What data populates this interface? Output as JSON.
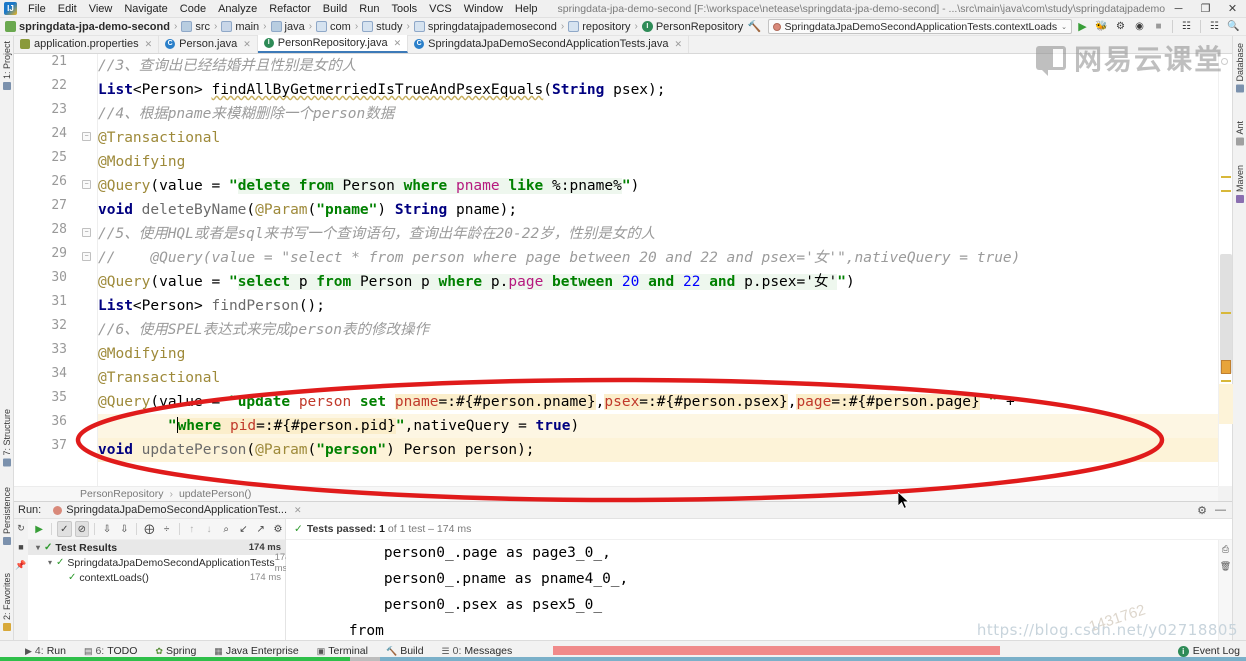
{
  "window": {
    "title": "springdata-jpa-demo-second [F:\\workspace\\netease\\springdata-jpa-demo-second] - ...\\src\\main\\java\\com\\study\\springdatajpademosecond\\repository\\PersonRepository.java - IntelliJ IDEA",
    "logo_letters": "IJ",
    "minimize": "─",
    "maximize": "❐",
    "close": "✕"
  },
  "menu": [
    "File",
    "Edit",
    "View",
    "Navigate",
    "Code",
    "Analyze",
    "Refactor",
    "Build",
    "Run",
    "Tools",
    "VCS",
    "Window",
    "Help"
  ],
  "breadcrumb": [
    {
      "label": "springdata-jpa-demo-second",
      "icon": "project-icon",
      "bold": true
    },
    {
      "label": "src",
      "icon": "folder-icon"
    },
    {
      "label": "main",
      "icon": "folder-icon"
    },
    {
      "label": "java",
      "icon": "source-folder-icon"
    },
    {
      "label": "com",
      "icon": "package-icon"
    },
    {
      "label": "study",
      "icon": "package-icon"
    },
    {
      "label": "springdatajpademosecond",
      "icon": "package-icon"
    },
    {
      "label": "repository",
      "icon": "package-icon"
    },
    {
      "label": "PersonRepository",
      "icon": "interface-icon",
      "glyph": "I"
    }
  ],
  "toolbar": {
    "build_icon": "hammer-icon",
    "run_config": "SpringdataJpaDemoSecondApplicationTests.contextLoads",
    "chevron": "⌄",
    "run_icon": "run-icon",
    "debug_icon": "debug-icon",
    "run_coverage_icon": "run-with-coverage-icon",
    "profile_icon": "profile-icon",
    "stop_icon": "stop-icon",
    "layout_icon": "layout-icon",
    "updates_icon": "updates-icon",
    "search_icon": "search-icon"
  },
  "tabs": [
    {
      "label": "application.properties",
      "icon": "properties-file-icon",
      "glyph": "",
      "active": false
    },
    {
      "label": "Person.java",
      "icon": "java-class-icon",
      "glyph": "C",
      "active": false
    },
    {
      "label": "PersonRepository.java",
      "icon": "java-interface-icon",
      "glyph": "I",
      "active": true
    },
    {
      "label": "SpringdataJpaDemoSecondApplicationTests.java",
      "icon": "java-class-icon",
      "glyph": "C",
      "active": false
    }
  ],
  "left_tool_tabs": [
    {
      "label": "1: Project",
      "icon": "project-panel-icon"
    },
    {
      "label": "7: Structure",
      "icon": "structure-panel-icon"
    },
    {
      "label": "Persistence",
      "icon": "persistence-panel-icon"
    },
    {
      "label": "2: Favorites",
      "icon": "favorites-star-icon"
    }
  ],
  "right_tool_tabs": [
    {
      "label": "Database",
      "icon": "database-panel-icon"
    },
    {
      "label": "Ant",
      "icon": "ant-panel-icon"
    },
    {
      "label": "Maven",
      "icon": "maven-panel-icon"
    }
  ],
  "editor": {
    "first_line": 21,
    "lines": [
      {
        "n": 21,
        "fold": false,
        "highlight": false
      },
      {
        "n": 22,
        "fold": false,
        "highlight": false
      },
      {
        "n": 23,
        "fold": false,
        "highlight": false
      },
      {
        "n": 24,
        "fold": true,
        "highlight": false
      },
      {
        "n": 25,
        "fold": false,
        "highlight": false
      },
      {
        "n": 26,
        "fold": true,
        "highlight": false
      },
      {
        "n": 27,
        "fold": false,
        "highlight": false
      },
      {
        "n": 28,
        "fold": true,
        "highlight": false
      },
      {
        "n": 29,
        "fold": true,
        "highlight": false
      },
      {
        "n": 30,
        "fold": false,
        "highlight": false
      },
      {
        "n": 31,
        "fold": false,
        "highlight": false
      },
      {
        "n": 32,
        "fold": false,
        "highlight": false
      },
      {
        "n": 33,
        "fold": false,
        "highlight": false
      },
      {
        "n": 34,
        "fold": false,
        "highlight": false
      },
      {
        "n": 35,
        "fold": false,
        "highlight": true
      },
      {
        "n": 36,
        "fold": false,
        "highlight": true
      },
      {
        "n": 37,
        "fold": false,
        "highlight": false
      }
    ],
    "code": {
      "l21": "//3、查询出已经结婚并且性别是女的人",
      "l22": "List<Person> findAllByGetmerriedIsTrueAndPsexEquals(String psex);",
      "l23": "//4、根据pname来模糊删除一个person数据",
      "l24": "@Transactional",
      "l25": "@Modifying",
      "l26": "@Query(value = \"delete from Person where pname like %:pname%\")",
      "l27": "void deleteByName(@Param(\"pname\") String pname);",
      "l28": "//5、使用HQL或者是sql来书写一个查询语句，查询出年龄在20-22岁，性别是女的人",
      "l29": "//    @Query(value = \"select * from person where page between 20 and 22 and psex='女'\",nativeQuery = true)",
      "l30": "@Query(value = \"select p from Person p where p.page between 20 and 22 and p.psex='女'\")",
      "l31": "List<Person> findPerson();",
      "l32": "//6、使用SPEL表达式来完成person表的修改操作",
      "l33": "@Modifying",
      "l34": "@Transactional",
      "l35": "@Query(value = \"update person set pname=:#{#person.pname},psex=:#{#person.psex},page=:#{#person.page} \" +",
      "l36": "        \"where pid=:#{#person.pid}\",nativeQuery = true)",
      "l37": "void updatePerson(@Param(\"person\") Person person);"
    },
    "breadcrumb": [
      "PersonRepository",
      "updatePerson()"
    ],
    "breadcrumb_sep": "›"
  },
  "run_panel": {
    "run_label": "Run:",
    "tab_title": "SpringdataJpaDemoSecondApplicationTest...",
    "close_glyph": "✕",
    "settings_icon": "gear-icon",
    "minimize_icon": "hide-icon",
    "toolbar_buttons": [
      {
        "name": "rerun-tests-icon",
        "glyph": "▶"
      },
      {
        "name": "show-passed-icon",
        "glyph": "✓",
        "active": true
      },
      {
        "name": "show-ignored-icon",
        "glyph": "⊘",
        "active": true
      },
      {
        "name": "sort-alphabetically-icon",
        "glyph": "↓ᴀ"
      },
      {
        "name": "sort-by-duration-icon",
        "glyph": "↓≡"
      },
      {
        "name": "expand-all-icon",
        "glyph": "⩟"
      },
      {
        "name": "collapse-all-icon",
        "glyph": "÷"
      },
      {
        "name": "previous-failed-icon",
        "glyph": "↑"
      },
      {
        "name": "next-failed-icon",
        "glyph": "↓"
      },
      {
        "name": "search-tests-icon",
        "glyph": "⌕"
      },
      {
        "name": "import-tests-icon",
        "glyph": "↙"
      },
      {
        "name": "export-tests-icon",
        "glyph": "↗"
      },
      {
        "name": "test-settings-icon",
        "glyph": "⚙"
      }
    ],
    "status": {
      "check": "✓",
      "prefix": "Tests passed:",
      "count": "1",
      "suffix": "of 1 test – 174 ms"
    },
    "tree": [
      {
        "label": "Test Results",
        "time": "174 ms",
        "depth": 0,
        "expanded": true,
        "selected": true
      },
      {
        "label": "SpringdataJpaDemoSecondApplicationTests",
        "time": "174 ms",
        "depth": 1,
        "expanded": true,
        "selected": false
      },
      {
        "label": "contextLoads()",
        "time": "174 ms",
        "depth": 2,
        "expanded": false,
        "selected": false
      }
    ],
    "console_lines": [
      "        person0_.page as page3_0_,",
      "        person0_.pname as pname4_0_,",
      "        person0_.psex as psex5_0_",
      "    from"
    ],
    "console_side_icons": [
      {
        "name": "print-icon",
        "glyph": "⎙"
      },
      {
        "name": "delete-icon",
        "glyph": "Ὕ1"
      }
    ]
  },
  "statusbar": {
    "items": [
      {
        "label": "Run",
        "icon": "run-tool-icon",
        "prefix": "▶ 4:"
      },
      {
        "label": "TODO",
        "icon": "todo-tool-icon",
        "prefix": "▤ 6:"
      },
      {
        "label": "Spring",
        "icon": "spring-tool-icon",
        "prefix": ""
      },
      {
        "label": "Java Enterprise",
        "icon": "java-enterprise-tool-icon",
        "prefix": ""
      },
      {
        "label": "Terminal",
        "icon": "terminal-tool-icon",
        "prefix": ""
      },
      {
        "label": "Build",
        "icon": "build-tool-icon",
        "prefix": ""
      },
      {
        "label": "Messages",
        "icon": "messages-tool-icon",
        "prefix": "0:"
      }
    ],
    "event_log": "Event Log",
    "event_log_icon": "event-log-icon"
  },
  "watermark": {
    "brand": "网易云课堂",
    "url": "https://blog.csdn.net/y02718805",
    "number": "1431762"
  },
  "colors": {
    "accent": "#3d7ab8",
    "annotation_red": "#e01b1b",
    "pass_green": "#2e9a2e",
    "highlight_row": "#fdf6e3",
    "spel_bg": "#fbeecb",
    "sql_bg": "#eef7ee"
  }
}
